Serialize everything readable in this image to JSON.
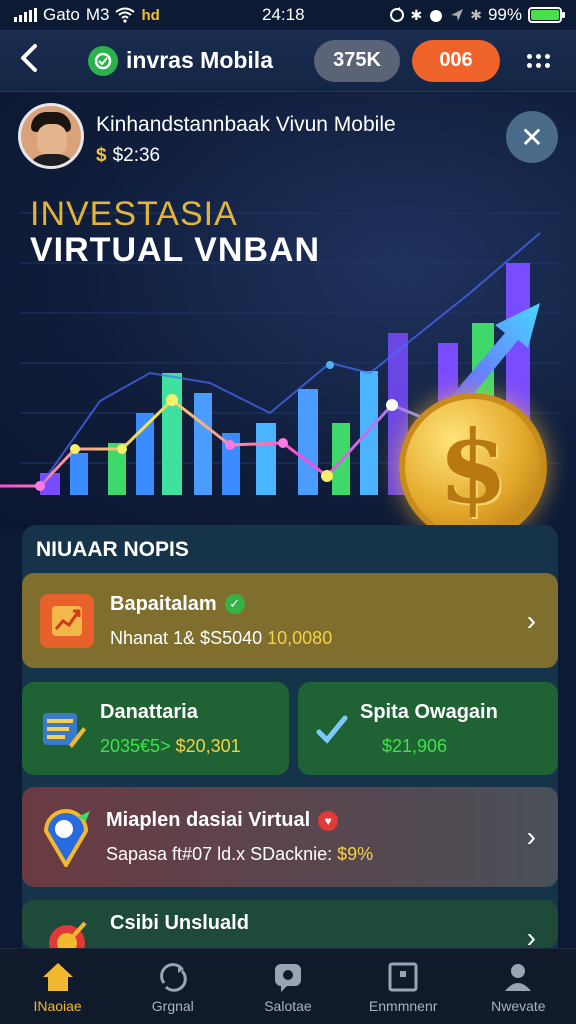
{
  "status_bar": {
    "carrier": "Gato",
    "network": "M3",
    "data_badge": "hd",
    "time": "24:18",
    "battery_percent": "99%",
    "battery_level": 0.99
  },
  "header": {
    "back_icon": "chevron-left-icon",
    "app_title": "invras Mobila",
    "pill_count": "375K",
    "pill_alert": "006",
    "more_icon": "grid-dots-icon"
  },
  "profile": {
    "name": "Kinhandstannbaak Vivun Mobile",
    "balance": "$2:36",
    "balance_symbol": "$"
  },
  "hero": {
    "title_line1": "INVESTASIA",
    "title_line2": "VIRTUAL VNBAN",
    "coin_symbol": "$"
  },
  "section": {
    "title": "NIUAAR NOPIS"
  },
  "cards": [
    {
      "title": "Bapaitalam",
      "sub_prefix": "Nhanat 1& $S5040",
      "sub_value": "10,0080",
      "color": "#7f6e2d"
    },
    {
      "title": "Danattaria",
      "sub_prefix": "2035€5>",
      "sub_value": "$20,301",
      "color": "#1f6233"
    },
    {
      "title": "Spita Owagain",
      "sub_prefix": "",
      "sub_value": "$21,906",
      "color": "#1f6233"
    },
    {
      "title": "Miaplen dasiai Virtual",
      "sub_prefix": "Sapasa ft#07 ld.x SDacknie:",
      "sub_value": "$9%",
      "color": "#5a3a40"
    },
    {
      "title": "Csibi Unsluald",
      "sub_prefix": "",
      "sub_value": "",
      "color": "#1e4a3a"
    }
  ],
  "nav": [
    {
      "label": "INaoiae",
      "icon": "home-icon"
    },
    {
      "label": "Grgnal",
      "icon": "refresh-icon"
    },
    {
      "label": "Salotae",
      "icon": "chat-icon"
    },
    {
      "label": "Enmmnenr",
      "icon": "frame-icon"
    },
    {
      "label": "Nwevate",
      "icon": "user-icon"
    }
  ],
  "colors": {
    "accent_gold": "#f2b830",
    "alert_orange": "#f0642b",
    "positive_green": "#3fe24a"
  }
}
